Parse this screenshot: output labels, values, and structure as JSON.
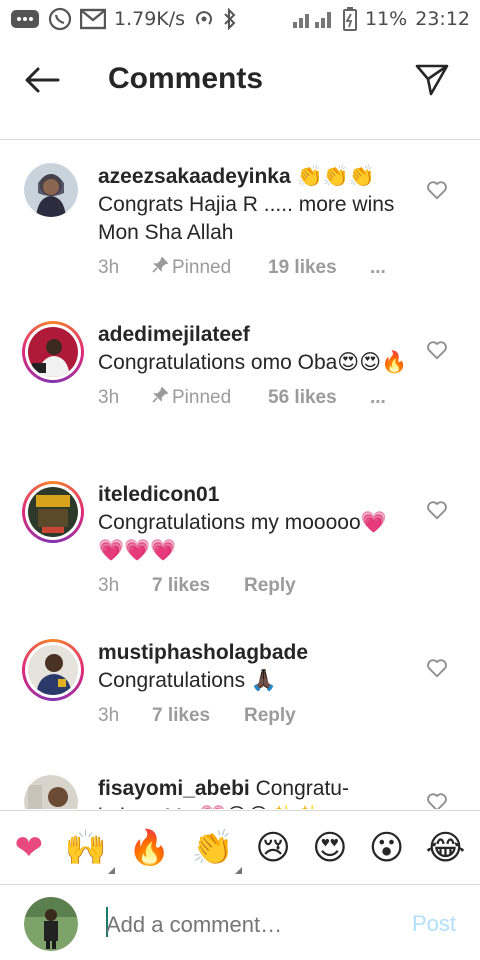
{
  "status_bar": {
    "speed": "1.79K/s",
    "battery": "11%",
    "time": "23:12"
  },
  "header": {
    "title": "Comments"
  },
  "comments": [
    {
      "username": "azeezsakaadeyinka",
      "text_suffix": "👏👏👏",
      "text": "Congrats Hajia R ..... more wins  Mon Sha Allah",
      "time": "3h",
      "pinned": "Pinned",
      "likes": "19 likes",
      "more": "..."
    },
    {
      "username": "adedimejilateef",
      "text": "Congratulations omo Oba😍😍🔥",
      "time": "3h",
      "pinned": "Pinned",
      "likes": "56 likes",
      "more": "..."
    },
    {
      "username": "iteledicon01",
      "text": "Congratulations my mooooo💗💗💗💗",
      "time": "3h",
      "likes": "7 likes",
      "reply": "Reply"
    },
    {
      "username": "mustiphasholagbade",
      "text": "Congratulations 🙏🏿",
      "time": "3h",
      "likes": "7 likes",
      "reply": "Reply"
    },
    {
      "username": "fisayomi_abebi",
      "text": "Congratu-lations Mo 💗😊😊✨✨"
    }
  ],
  "emoji_bar": [
    "❤",
    "🙌",
    "🔥",
    "👏",
    "😢",
    "😍",
    "😮",
    "😂"
  ],
  "composer": {
    "placeholder": "Add a comment…",
    "post_label": "Post"
  },
  "colors": {
    "post_disabled": "#b2dffc",
    "meta_gray": "#9b9b9b",
    "heart_outline": "#8e8e8e",
    "ring_start": "#f58529",
    "ring_mid": "#dd2a7b"
  }
}
